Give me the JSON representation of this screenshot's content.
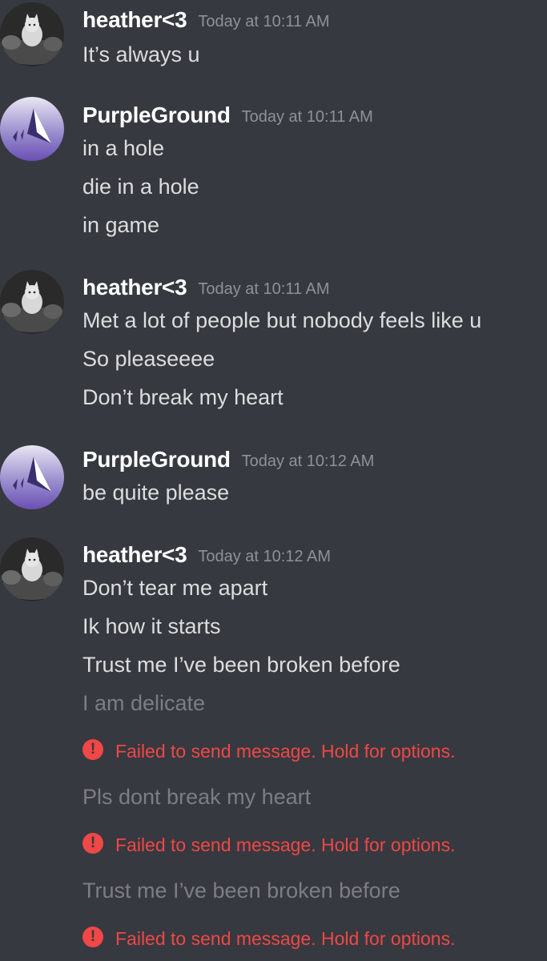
{
  "messages": [
    {
      "author": "heather<3",
      "time": "Today at 10:11 AM",
      "avatar_icon": "kitten-avatar-icon",
      "lines": [
        {
          "text": "It’s always u"
        }
      ]
    },
    {
      "author": "PurpleGround",
      "time": "Today at 10:11 AM",
      "avatar_icon": "purple-triangle-avatar-icon",
      "lines": [
        {
          "text": "in a hole"
        },
        {
          "text": "die in a hole"
        },
        {
          "text": "in game"
        }
      ]
    },
    {
      "author": "heather<3",
      "time": "Today at 10:11 AM",
      "avatar_icon": "kitten-avatar-icon",
      "lines": [
        {
          "text": "Met a lot of people but nobody feels like u"
        },
        {
          "text": "So pleaseeee"
        },
        {
          "text": "Don’t break my heart"
        }
      ]
    },
    {
      "author": "PurpleGround",
      "time": "Today at 10:12 AM",
      "avatar_icon": "purple-triangle-avatar-icon",
      "lines": [
        {
          "text": "be quite please"
        }
      ]
    },
    {
      "author": "heather<3",
      "time": "Today at 10:12 AM",
      "avatar_icon": "kitten-avatar-icon",
      "lines": [
        {
          "text": "Don’t tear me apart"
        },
        {
          "text": "Ik how it starts"
        },
        {
          "text": "Trust me I’ve been broken before"
        },
        {
          "text": "I am delicate",
          "failed": true
        },
        {
          "text": "Pls dont break my heart",
          "failed": true
        },
        {
          "text": "Trust me I’ve been broken before",
          "failed": true
        }
      ]
    }
  ],
  "error_text": "Failed to send message. Hold for options.",
  "error_icon_glyph": "!",
  "colors": {
    "background": "#36393f",
    "username": "#ffffff",
    "timestamp": "#8e9297",
    "message": "#dcddde",
    "failed_message": "#7c7e82",
    "error": "#f04747"
  }
}
